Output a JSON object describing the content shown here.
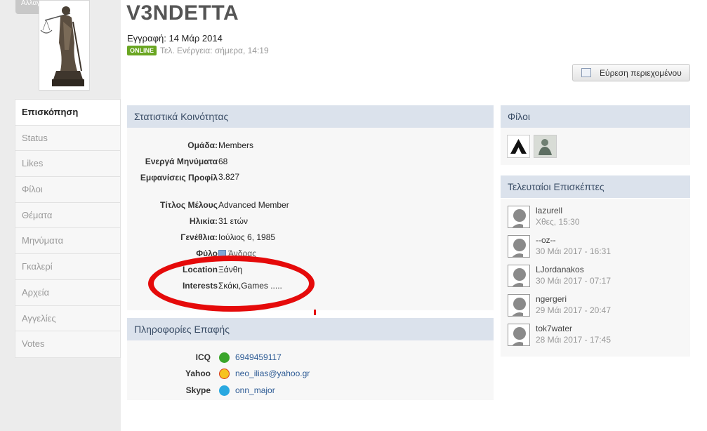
{
  "sidebar": {
    "change_label": "Αλλαγή",
    "items": [
      {
        "label": "Επισκόπηση",
        "active": true
      },
      {
        "label": "Status"
      },
      {
        "label": "Likes"
      },
      {
        "label": "Φίλοι"
      },
      {
        "label": "Θέματα"
      },
      {
        "label": "Μηνύματα"
      },
      {
        "label": "Γκαλερί"
      },
      {
        "label": "Αρχεία"
      },
      {
        "label": "Αγγελίες"
      },
      {
        "label": "Votes"
      }
    ]
  },
  "profile": {
    "username": "V3NDETTA",
    "joined": "Εγγραφή: 14 Μάρ 2014",
    "online_badge": "ONLINE",
    "last_activity": "Τελ. Ενέργεια: σήμερα, 14:19"
  },
  "find_content_button": "Εύρεση περιεχομένου",
  "stats": {
    "title": "Στατιστικά Κοινότητας",
    "rows": [
      {
        "label": "Ομάδα:",
        "value": "Members"
      },
      {
        "label": "Ενεργά Μηνύματα",
        "value": "68"
      },
      {
        "label": "Εμφανίσεις Προφίλ",
        "value": "3.827"
      },
      {
        "label": "Τίτλος Μέλους",
        "value": "Advanced Member"
      },
      {
        "label": "Ηλικία:",
        "value": "31 ετών"
      },
      {
        "label": "Γενέθλια:",
        "value": "Ιούλιος 6, 1985"
      },
      {
        "label": "Φύλο",
        "value": "Άνδρας"
      },
      {
        "label": "Location",
        "value": "Ξάνθη"
      },
      {
        "label": "Interests",
        "value": "Σκάκι,Games ....."
      }
    ]
  },
  "contact": {
    "title": "Πληροφορίες Επαφής",
    "rows": [
      {
        "label": "ICQ",
        "value": "6949459117",
        "icon": "icq-flower-icon"
      },
      {
        "label": "Yahoo",
        "value": "neo_ilias@yahoo.gr",
        "icon": "yahoo-smiley-icon"
      },
      {
        "label": "Skype",
        "value": "onn_major",
        "icon": "skype-icon"
      }
    ]
  },
  "friends": {
    "title": "Φίλοι"
  },
  "visitors": {
    "title": "Τελευταίοι Επισκέπτες",
    "items": [
      {
        "name": "lazurell",
        "time": "Χθες, 15:30"
      },
      {
        "name": "--oz--",
        "time": "30 Μάι 2017 - 16:31"
      },
      {
        "name": "LJordanakos",
        "time": "30 Μάι 2017 - 07:17"
      },
      {
        "name": "ngergeri",
        "time": "29 Μάι 2017 - 20:47"
      },
      {
        "name": "tok7water",
        "time": "28 Μάι 2017 - 17:45"
      }
    ]
  },
  "colors": {
    "online": "#6aa622",
    "section_head": "#dbe2ec",
    "link": "#2c5a94",
    "annotation": "#e50a0a"
  }
}
